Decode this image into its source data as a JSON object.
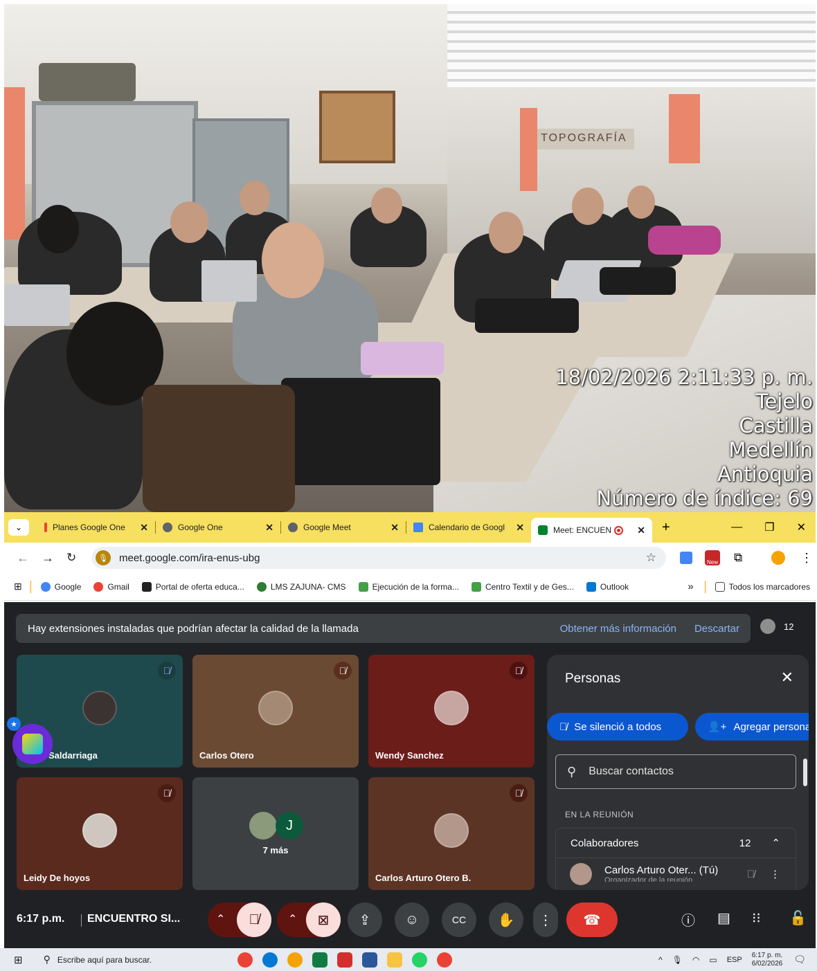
{
  "photo": {
    "timestamp": "18/02/2026 2:11:33 p. m.",
    "loc1": "Tejelo",
    "loc2": "Castilla",
    "loc3": "Medellín",
    "loc4": "Antioquia",
    "index": "Número de índice: 69",
    "sign": "TOPOGRAFÍA"
  },
  "browser": {
    "tabs": [
      {
        "title": "Planes Google One",
        "favicon_color": "#ea4335"
      },
      {
        "title": "Google One",
        "favicon_color": "#5f6368"
      },
      {
        "title": "Google Meet",
        "favicon_color": "#5f6368"
      },
      {
        "title": "Calendario de Googl",
        "favicon_color": "#4285f4"
      },
      {
        "title": "Meet: ENCUENT",
        "favicon_color": "#00832d",
        "recording_color": "#d93025"
      }
    ],
    "new_tab": "+",
    "url": "meet.google.com/ira-enus-ubg",
    "bookmarks": [
      {
        "label": "Google",
        "color": "#4285f4"
      },
      {
        "label": "Gmail",
        "color": "#ea4335"
      },
      {
        "label": "Portal de oferta educa...",
        "color": "#222"
      },
      {
        "label": "LMS ZAJUNA- CMS",
        "color": "#2e7d32"
      },
      {
        "label": "Ejecución de la forma...",
        "color": "#43a047"
      },
      {
        "label": "Centro Textil y de Ges...",
        "color": "#43a047"
      },
      {
        "label": "Outlook",
        "color": "#0078d4"
      }
    ],
    "more": "»",
    "all_bookmarks": "Todos los marcadores"
  },
  "meet": {
    "banner": {
      "message": "Hay extensiones instaladas que podrían afectar la calidad de la llamada",
      "learn_more": "Obtener más información",
      "dismiss": "Descartar"
    },
    "participant_count": "12",
    "tiles": [
      {
        "name": "Saldarriaga",
        "bg": "#1f4a4d",
        "mic_bg": "#1a3d40"
      },
      {
        "name": "Carlos Otero",
        "bg": "#6b4a34",
        "mic_bg": "#5a2f1d"
      },
      {
        "name": "Wendy Sanchez",
        "bg": "#6b1d1a",
        "mic_bg": "#4d1210"
      },
      {
        "name": "Leidy De hoyos",
        "bg": "#5a2a1f",
        "mic_bg": "#4a1c13"
      },
      {
        "name": "7 más",
        "bg": "#3c4043",
        "extra_initial": "J"
      },
      {
        "name": "Carlos Arturo Otero B.",
        "bg": "#5c3426",
        "mic_bg": "#4a1c13"
      }
    ],
    "people_panel": {
      "title": "Personas",
      "mute_all": "Se silenció a todos",
      "add_people": "Agregar persona",
      "search_placeholder": "Buscar contactos",
      "in_meeting": "EN LA REUNIÓN",
      "collaborators": "Colaboradores",
      "collaborators_count": "12",
      "me_name": "Carlos Arturo Oter...",
      "me_tag": "(Tú)",
      "me_role": "Organizador de la reunión"
    },
    "controls": {
      "time": "6:17 p.m.",
      "meeting_name": "ENCUENTRO SI..."
    }
  },
  "taskbar": {
    "search_placeholder": "Escribe aquí para buscar.",
    "lang": "ESP",
    "time": "6:17 p. m.",
    "date": "6/02/2026"
  }
}
